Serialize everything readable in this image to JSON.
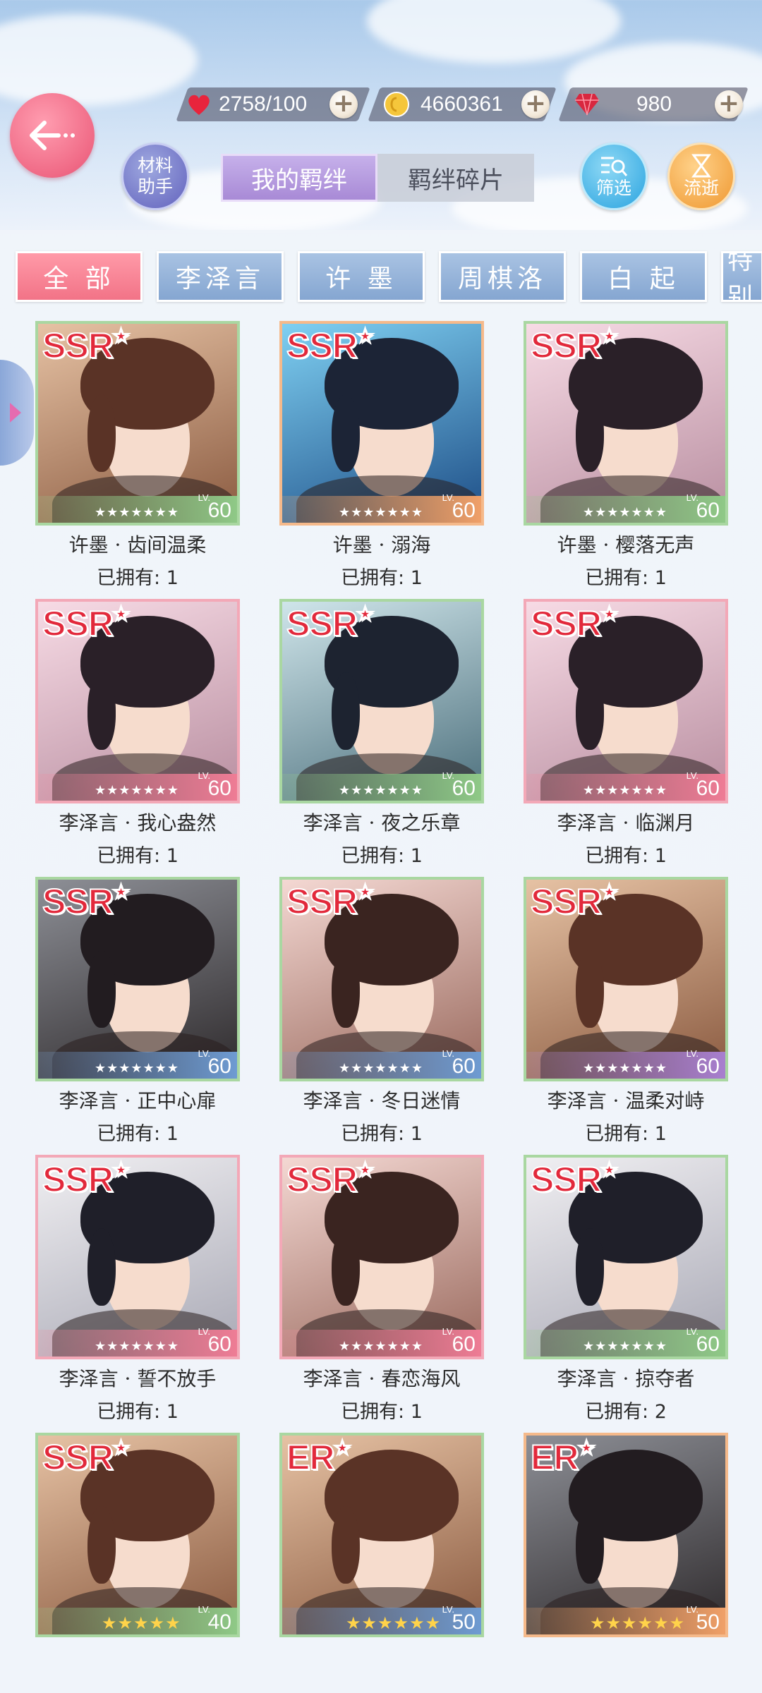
{
  "resources": [
    {
      "icon": "heart-icon",
      "value": "2758/100"
    },
    {
      "icon": "gold-coin-icon",
      "value": "4660361"
    },
    {
      "icon": "diamond-icon",
      "value": "980"
    }
  ],
  "header": {
    "material_helper": "材料助手",
    "tabs": [
      {
        "label": "我的羁绊",
        "active": true
      },
      {
        "label": "羁绊碎片",
        "active": false
      }
    ],
    "filter_button": "筛选",
    "flow_button": "流逝"
  },
  "character_filters": [
    {
      "label": "全 部",
      "active": true
    },
    {
      "label": "李泽言",
      "active": false
    },
    {
      "label": "许 墨",
      "active": false
    },
    {
      "label": "周棋洛",
      "active": false
    },
    {
      "label": "白 起",
      "active": false
    },
    {
      "label": "特别",
      "active": false
    }
  ],
  "cards": [
    {
      "rarity": "SSR",
      "name": "许墨 · 齿间温柔",
      "owned": "已拥有: 1",
      "level": "60",
      "stars": "★★★★★★★",
      "band": "green",
      "theme": "warm"
    },
    {
      "rarity": "SSR",
      "name": "许墨 · 溺海",
      "owned": "已拥有: 1",
      "level": "60",
      "stars": "★★★★★★★",
      "band": "orange",
      "theme": "blue"
    },
    {
      "rarity": "SSR",
      "name": "许墨 · 樱落无声",
      "owned": "已拥有: 1",
      "level": "60",
      "stars": "★★★★★★★",
      "band": "green",
      "theme": "pink"
    },
    {
      "rarity": "SSR",
      "name": "李泽言 · 我心盎然",
      "owned": "已拥有: 1",
      "level": "60",
      "stars": "★★★★★★★",
      "band": "pink",
      "theme": "pink"
    },
    {
      "rarity": "SSR",
      "name": "李泽言 · 夜之乐章",
      "owned": "已拥有: 1",
      "level": "60",
      "stars": "★★★★★★★",
      "band": "green",
      "theme": "teal"
    },
    {
      "rarity": "SSR",
      "name": "李泽言 · 临渊月",
      "owned": "已拥有: 1",
      "level": "60",
      "stars": "★★★★★★★",
      "band": "pink",
      "theme": "pink"
    },
    {
      "rarity": "SSR",
      "name": "李泽言 · 正中心扉",
      "owned": "已拥有: 1",
      "level": "60",
      "stars": "★★★★★★★",
      "band": "blue",
      "theme": "dark"
    },
    {
      "rarity": "SSR",
      "name": "李泽言 · 冬日迷情",
      "owned": "已拥有: 1",
      "level": "60",
      "stars": "★★★★★★★",
      "band": "blue",
      "theme": "rose"
    },
    {
      "rarity": "SSR",
      "name": "李泽言 · 温柔对峙",
      "owned": "已拥有: 1",
      "level": "60",
      "stars": "★★★★★★★",
      "band": "purple",
      "theme": "warm"
    },
    {
      "rarity": "SSR",
      "name": "李泽言 · 誓不放手",
      "owned": "已拥有: 1",
      "level": "60",
      "stars": "★★★★★★★",
      "band": "pink",
      "theme": "light"
    },
    {
      "rarity": "SSR",
      "name": "李泽言 · 春恋海风",
      "owned": "已拥有: 1",
      "level": "60",
      "stars": "★★★★★★★",
      "band": "pink",
      "theme": "rose"
    },
    {
      "rarity": "SSR",
      "name": "李泽言 · 掠夺者",
      "owned": "已拥有: 2",
      "level": "60",
      "stars": "★★★★★★★",
      "band": "green",
      "theme": "light"
    },
    {
      "rarity": "SSR",
      "name": "",
      "owned": "",
      "level": "40",
      "stars": "★★★★★",
      "band": "green",
      "theme": "warm"
    },
    {
      "rarity": "ER",
      "name": "",
      "owned": "",
      "level": "50",
      "stars": "★★★★★★",
      "band": "blue",
      "theme": "warm"
    },
    {
      "rarity": "ER",
      "name": "",
      "owned": "",
      "level": "50",
      "stars": "★★★★★★",
      "band": "orange",
      "theme": "dark"
    }
  ]
}
